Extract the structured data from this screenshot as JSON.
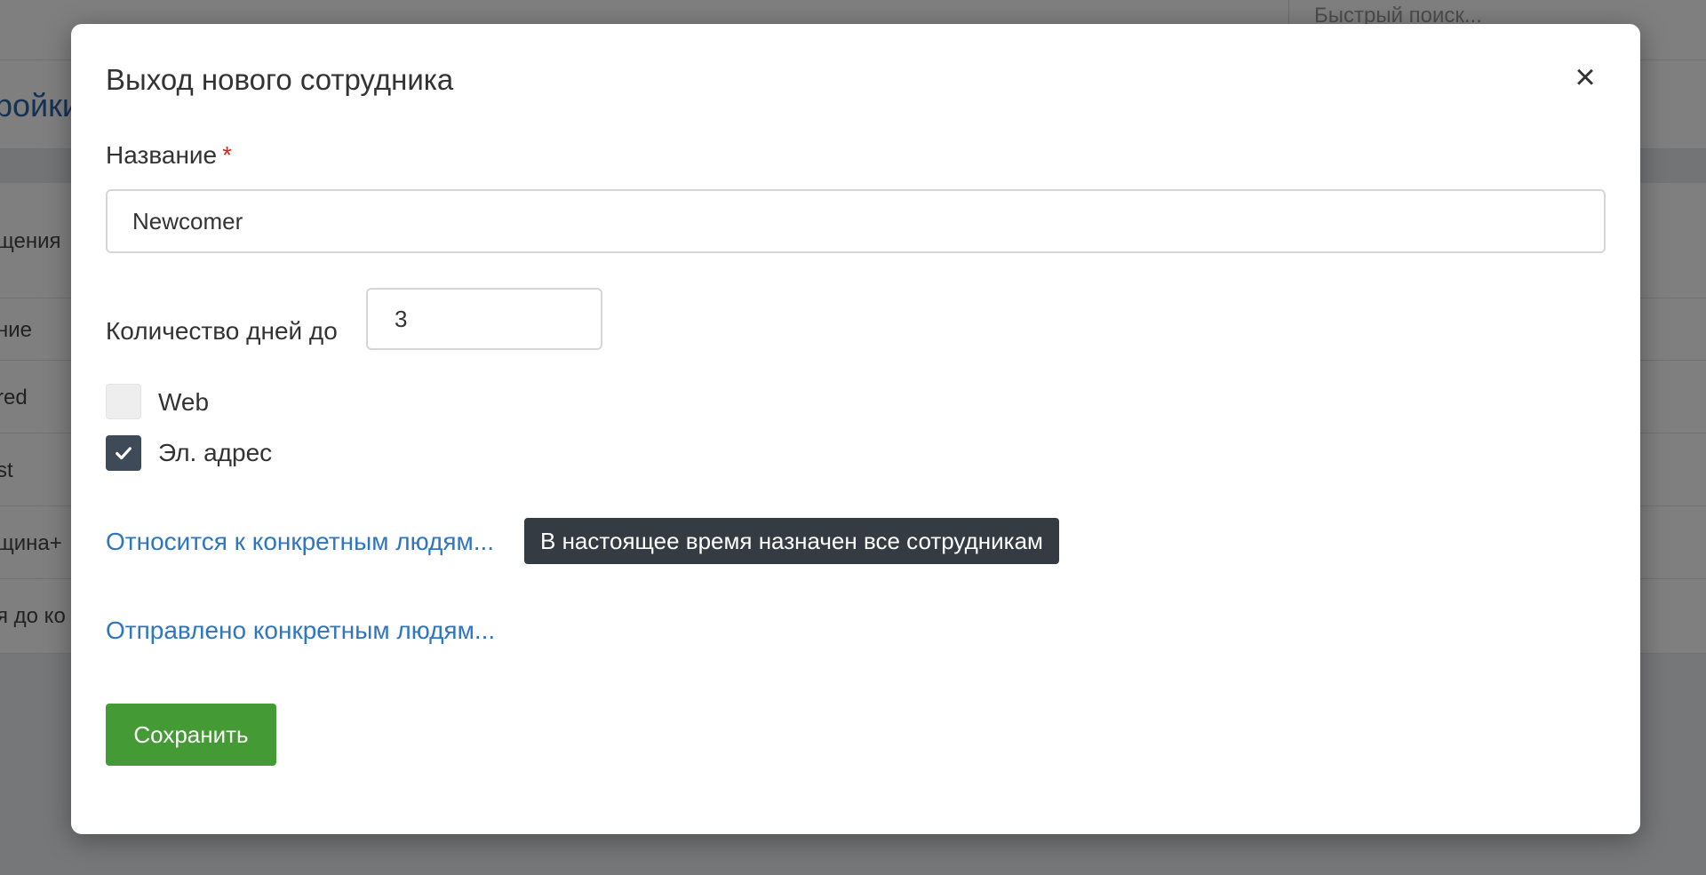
{
  "background": {
    "search_placeholder": "Быстрый поиск...",
    "heading_fragment": "ройки",
    "rows": [
      "щения",
      "ние",
      "red",
      "st",
      "щина+",
      "я до ко"
    ]
  },
  "modal": {
    "title": "Выход нового сотрудника",
    "close_symbol": "×",
    "name_label": "Название",
    "required_mark": "*",
    "name_value": "Newcomer",
    "days_label": "Количество дней до",
    "days_value": "3",
    "checkboxes": [
      {
        "label": "Web",
        "checked": false
      },
      {
        "label": "Эл. адрес",
        "checked": true
      }
    ],
    "applies_link": "Относится к конкретным людям...",
    "tooltip": "В настоящее время назначен все сотрудникам",
    "sent_link": "Отправлено конкретным людям...",
    "save_label": "Сохранить"
  },
  "colors": {
    "accent_link": "#2f75c0",
    "save_button": "#449a34",
    "tooltip_bg": "#343b43",
    "required": "#d9261c"
  },
  "icons": {
    "close": "close-icon",
    "check": "check-icon"
  }
}
